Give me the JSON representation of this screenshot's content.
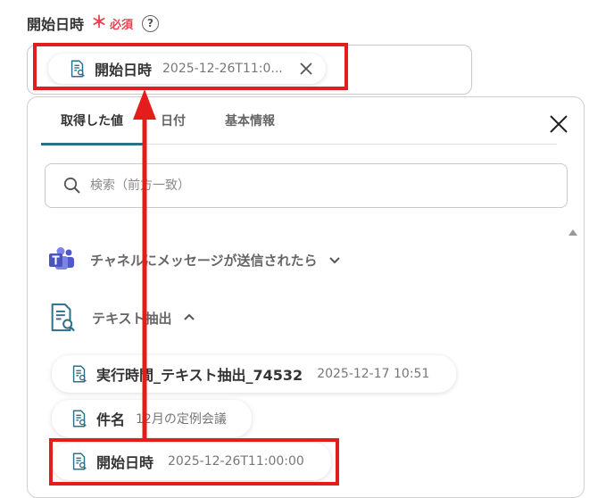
{
  "field": {
    "label": "開始日時",
    "required_mark": "＊",
    "required_text": "必須",
    "help_glyph": "?"
  },
  "selected_chip": {
    "name": "開始日時",
    "value": "2025-12-26T11:0..."
  },
  "panel": {
    "tabs": [
      {
        "label": "取得した値",
        "active": true
      },
      {
        "label": "日付",
        "active": false
      },
      {
        "label": "基本情報",
        "active": false
      }
    ],
    "search_placeholder": "検索（前方一致）",
    "sections": [
      {
        "name": "チャネルにメッセージが送信されたら",
        "icon": "teams-icon",
        "expanded": false
      },
      {
        "name": "テキスト抽出",
        "icon": "document-search-icon",
        "expanded": true
      }
    ],
    "items": [
      {
        "name": "実行時間_テキスト抽出_74532",
        "value": "2025-12-17 10:51"
      },
      {
        "name": "件名",
        "value": "12月の定例会議"
      },
      {
        "name": "開始日時",
        "value": "2025-12-26T11:00:00"
      }
    ]
  },
  "colors": {
    "accent": "#2b6f8a",
    "required": "#e8434f",
    "annotation_red": "#e31c1c",
    "teams_purple": "#5059c9"
  }
}
